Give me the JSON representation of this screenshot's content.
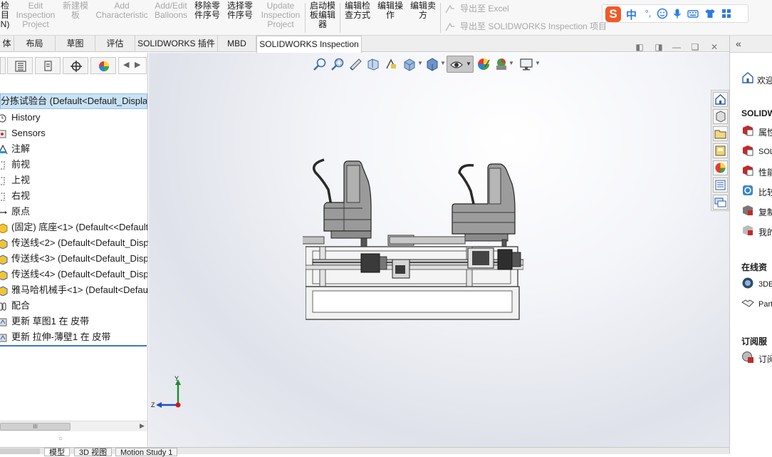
{
  "ribbon": {
    "buttons": [
      {
        "label": "检\n目\nN)",
        "disabled": false
      },
      {
        "label": "Edit\nInspection\nProject",
        "disabled": true
      },
      {
        "label": "新建模\n板",
        "disabled": true
      },
      {
        "label": "Add\nCharacteristic",
        "disabled": true
      },
      {
        "label": "Add/Edit\nBalloons",
        "disabled": true
      },
      {
        "label": "移除零\n件序号",
        "disabled": false
      },
      {
        "label": "选择零\n件序号",
        "disabled": false
      },
      {
        "label": "Update\nInspection\nProject",
        "disabled": true
      },
      {
        "label": "启动模\n板编辑\n器",
        "disabled": false
      },
      {
        "label": "编辑检\n查方式",
        "disabled": false
      },
      {
        "label": "编辑操\n作",
        "disabled": false
      },
      {
        "label": "编辑卖\n方",
        "disabled": false
      }
    ],
    "export_excel": "导出至 Excel",
    "export_inspection": "导出至 SOLIDWORKS Inspection 项目"
  },
  "ime": {
    "logo": "S",
    "mode": "中",
    "punct": "°,"
  },
  "tabs": [
    {
      "label": "体",
      "active": false
    },
    {
      "label": "布局",
      "active": false
    },
    {
      "label": "草图",
      "active": false
    },
    {
      "label": "评估",
      "active": false
    },
    {
      "label": "SOLIDWORKS 插件",
      "active": false
    },
    {
      "label": "MBD",
      "active": false
    },
    {
      "label": "SOLIDWORKS Inspection",
      "active": true
    }
  ],
  "tree": {
    "root": "分拣试验台 (Default<Default_Display",
    "items": [
      {
        "label": "History",
        "icon": "history-icon"
      },
      {
        "label": "Sensors",
        "icon": "sensors-icon"
      },
      {
        "label": "注解",
        "icon": "annotations-icon"
      },
      {
        "label": "前视",
        "icon": "plane-icon"
      },
      {
        "label": "上视",
        "icon": "plane-icon"
      },
      {
        "label": "右视",
        "icon": "plane-icon"
      },
      {
        "label": "原点",
        "icon": "origin-icon"
      },
      {
        "label": "(固定) 底座<1> (Default<<Default",
        "icon": "part-icon"
      },
      {
        "label": "传送线<2> (Default<Default_Disp",
        "icon": "assembly-icon"
      },
      {
        "label": "传送线<3> (Default<Default_Disp",
        "icon": "assembly-icon"
      },
      {
        "label": "传送线<4> (Default<Default_Disp",
        "icon": "assembly-icon"
      },
      {
        "label": "雅马哈机械手<1> (Default<Defau",
        "icon": "assembly-icon"
      },
      {
        "label": "配合",
        "icon": "mates-icon"
      },
      {
        "label": "更新 草图1 在 皮带",
        "icon": "feature-icon"
      },
      {
        "label": "更新 拉伸-薄壁1 在 皮带",
        "icon": "feature-icon"
      }
    ],
    "scroll_label": "III"
  },
  "triad": {
    "y": "Y",
    "z": "Z"
  },
  "taskpane": {
    "welcome": "欢迎",
    "section1": "SOLIDWO",
    "section1_items": [
      "属性",
      "SOL",
      "性能",
      "比较",
      "复制",
      "我的"
    ],
    "section2": "在线资",
    "section2_items": [
      "3DE",
      "Part"
    ],
    "section3": "订阅服",
    "section3_items": [
      "订阅"
    ]
  },
  "bottom_tabs": [
    "模型",
    "3D 视图",
    "Motion Study 1"
  ],
  "colors": {
    "accent": "#3c79c2",
    "selected_bg": "#c9e2f5"
  }
}
